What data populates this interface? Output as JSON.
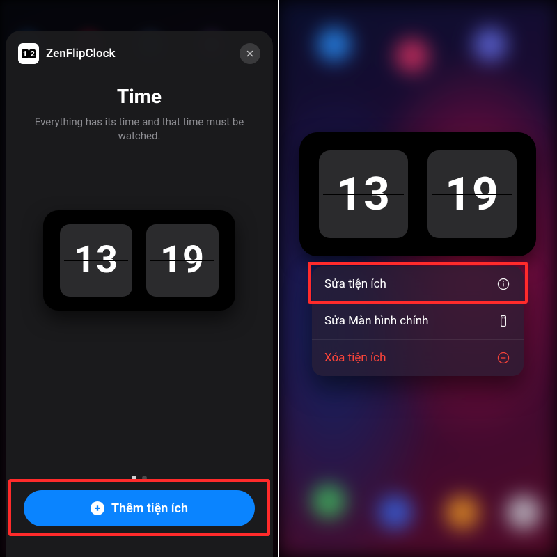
{
  "left": {
    "app_name": "ZenFlipClock",
    "app_badge_digits": [
      "1",
      "2"
    ],
    "title": "Time",
    "subtitle": "Everything has its time and that time must be watched.",
    "clock": {
      "hours": "13",
      "minutes": "19"
    },
    "pager": {
      "count": 2,
      "active_index": 0
    },
    "add_button_label": "Thêm tiện ích"
  },
  "right": {
    "clock": {
      "hours": "13",
      "minutes": "19"
    },
    "context_menu": {
      "items": [
        {
          "label": "Sửa tiện ích",
          "icon": "info",
          "style": "default"
        },
        {
          "label": "Sửa Màn hình chính",
          "icon": "phone-rect",
          "style": "default"
        },
        {
          "label": "Xóa tiện ích",
          "icon": "minus-circle",
          "style": "danger"
        }
      ],
      "highlighted_index": 0
    }
  },
  "colors": {
    "accent": "#0a84ff",
    "danger": "#ff453a",
    "highlight": "#ff2b2b"
  }
}
